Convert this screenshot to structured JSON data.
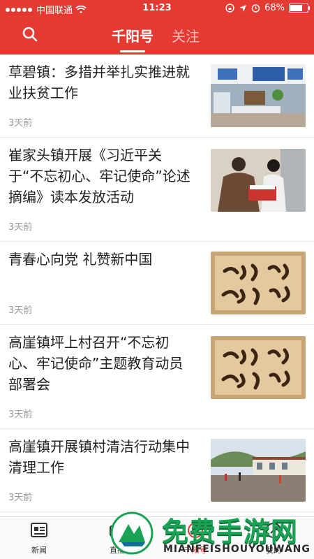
{
  "status": {
    "carrier": "中国联通",
    "time": "11:23",
    "battery": "68%"
  },
  "navbar": {
    "tabs": [
      {
        "label": "千阳号",
        "active": true
      },
      {
        "label": "关注",
        "active": false
      }
    ]
  },
  "articles": [
    {
      "title": "草碧镇：多措并举扎实推进就业扶贫工作",
      "time": "3天前",
      "image": "office-photo"
    },
    {
      "title": "崔家头镇开展《习近平关于“不忘初心、牢记使命”论述摘编》读本发放活动",
      "time": "3天前",
      "image": "people-signing-photo"
    },
    {
      "title": "青春心向党 礼赞新中国",
      "time": "3天前",
      "image": "calligraphy-photo"
    },
    {
      "title": "高崖镇坪上村召开“不忘初心、牢记使命”主题教育动员部署会",
      "time": "3天前",
      "image": "calligraphy-photo"
    },
    {
      "title": "高崖镇开展镇村清洁行动集中清理工作",
      "time": "3天前",
      "image": "village-photo"
    }
  ],
  "tabbar": [
    {
      "label": "新闻",
      "icon": "news-icon"
    },
    {
      "label": "直播",
      "icon": "live-icon"
    },
    {
      "label": "千阳号",
      "icon": "qianyang-icon",
      "active": true
    },
    {
      "label": "我的",
      "icon": "profile-icon"
    }
  ],
  "watermark": {
    "title": "免费手游网",
    "subtitle": "MIANFEISHOUYOUWANG"
  },
  "colors": {
    "brand": "#e43a32",
    "watermark": "#1aa354"
  }
}
